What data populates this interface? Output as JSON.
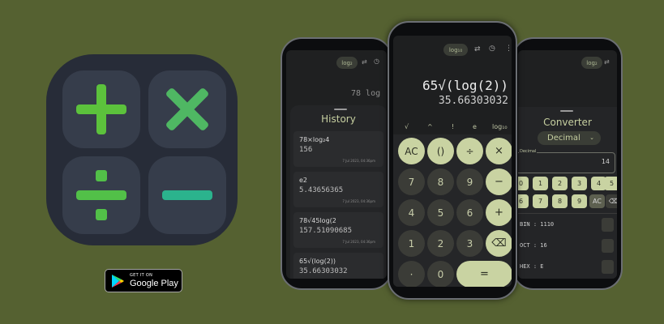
{
  "store_badge": {
    "small": "GET IT ON",
    "big": "Google Play"
  },
  "left_phone": {
    "mode": "log₂",
    "display_partial": "78 log",
    "panel_title": "History",
    "history": [
      {
        "expr": "78×log₂4",
        "result": "156",
        "time": "7 Jul 2023, 04:36pm"
      },
      {
        "expr": "e2",
        "result": "5.43656365",
        "time": "7 Jul 2023, 04:36pm"
      },
      {
        "expr": "78√45log(2",
        "result": "157.51090685",
        "time": "7 Jul 2023, 04:36pm"
      },
      {
        "expr": "65√(log(2))",
        "result": "35.66303032",
        "time": ""
      }
    ]
  },
  "center_phone": {
    "mode": "log₁₀",
    "expression": "65√(log(2))",
    "result": "35.66303032",
    "functions": [
      "√",
      "^",
      "!",
      "e",
      "log₁₀"
    ],
    "keys": {
      "ac": "AC",
      "paren": "()",
      "divide": "÷",
      "multiply": "×",
      "seven": "7",
      "eight": "8",
      "nine": "9",
      "minus": "−",
      "four": "4",
      "five": "5",
      "six": "6",
      "plus": "+",
      "one": "1",
      "two": "2",
      "three": "3",
      "backspace": "⌫",
      "dot": "·",
      "zero": "0",
      "equals": "="
    }
  },
  "right_phone": {
    "mode": "log₂",
    "panel_title": "Converter",
    "base_select": "Decimal",
    "field_label": "Decimal",
    "field_value": "14",
    "keys": [
      "0",
      "1",
      "2",
      "3",
      "4",
      "5",
      "6",
      "7",
      "8",
      "9",
      "AC",
      "⌫"
    ],
    "rows": [
      {
        "label": "BIN : 1110"
      },
      {
        "label": "OCT : 16"
      },
      {
        "label": "HEX : E"
      }
    ]
  },
  "colors": {
    "background": "#556131",
    "accent_green": "#5fbf3a",
    "teal": "#2bb38d",
    "key_light": "#c9d3a2"
  }
}
